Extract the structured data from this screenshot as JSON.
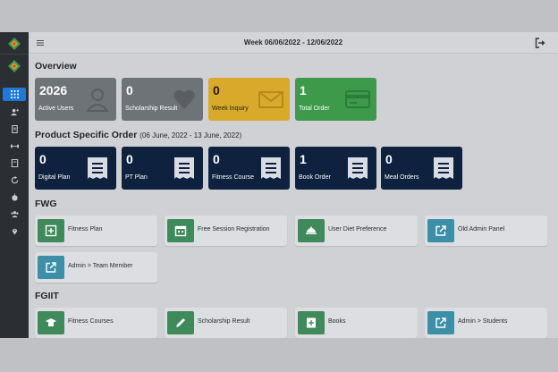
{
  "topbar": {
    "week_label": "Week 06/06/2022 - 12/06/2022"
  },
  "sidebar": {
    "items": [
      {
        "icon": "dashboard-grid-icon",
        "active": true
      },
      {
        "icon": "user-plus-icon"
      },
      {
        "icon": "document-icon"
      },
      {
        "icon": "dumbbell-icon"
      },
      {
        "icon": "book-icon"
      },
      {
        "icon": "refresh-icon"
      },
      {
        "icon": "apple-icon"
      },
      {
        "icon": "users-icon"
      },
      {
        "icon": "map-pin-icon"
      }
    ]
  },
  "overview": {
    "title": "Overview",
    "cards": [
      {
        "value": "2026",
        "label": "Active Users",
        "icon": "user-icon",
        "color": "#6e7378"
      },
      {
        "value": "0",
        "label": "Scholarship Result",
        "icon": "heart-icon",
        "color": "#6e7378"
      },
      {
        "value": "0",
        "label": "Week Inquiry",
        "icon": "envelope-icon",
        "color": "#d8a92a"
      },
      {
        "value": "1",
        "label": "Total Order",
        "icon": "credit-card-icon",
        "color": "#3c9a4a"
      }
    ]
  },
  "product_order": {
    "title": "Product Specific Order",
    "date_range": "(06 June, 2022 - 13 June, 2022)",
    "cards": [
      {
        "value": "0",
        "label": "Digital Plan",
        "icon": "receipt-icon"
      },
      {
        "value": "0",
        "label": "PT Plan",
        "icon": "receipt-icon"
      },
      {
        "value": "0",
        "label": "Fitness Course",
        "icon": "receipt-icon"
      },
      {
        "value": "1",
        "label": "Book Order",
        "icon": "receipt-icon"
      },
      {
        "value": "0",
        "label": "Meal Orders",
        "icon": "receipt-icon"
      }
    ]
  },
  "fwg": {
    "title": "FWG",
    "tiles": [
      {
        "label": "Fitness Plan",
        "icon": "plus-square-icon",
        "color": "#3f8a5b"
      },
      {
        "label": "Free Session Registration",
        "icon": "calendar-icon",
        "color": "#3f8a5b"
      },
      {
        "label": "User Diet Preference",
        "icon": "diet-tray-icon",
        "color": "#3f8a5b"
      },
      {
        "label": "Old Admin Panel",
        "icon": "external-link-icon",
        "color": "#3c8fa6"
      },
      {
        "label": "Admin > Team Member",
        "icon": "external-link-icon",
        "color": "#3c8fa6"
      }
    ]
  },
  "fgiit": {
    "title": "FGIIT",
    "tiles": [
      {
        "label": "Fitness Courses",
        "icon": "graduation-icon",
        "color": "#3f8a5b"
      },
      {
        "label": "Scholarship Result",
        "icon": "pen-icon",
        "color": "#3f8a5b"
      },
      {
        "label": "Books",
        "icon": "book-plus-icon",
        "color": "#3f8a5b"
      },
      {
        "label": "Admin > Students",
        "icon": "external-link-icon",
        "color": "#3c8fa6"
      }
    ]
  }
}
